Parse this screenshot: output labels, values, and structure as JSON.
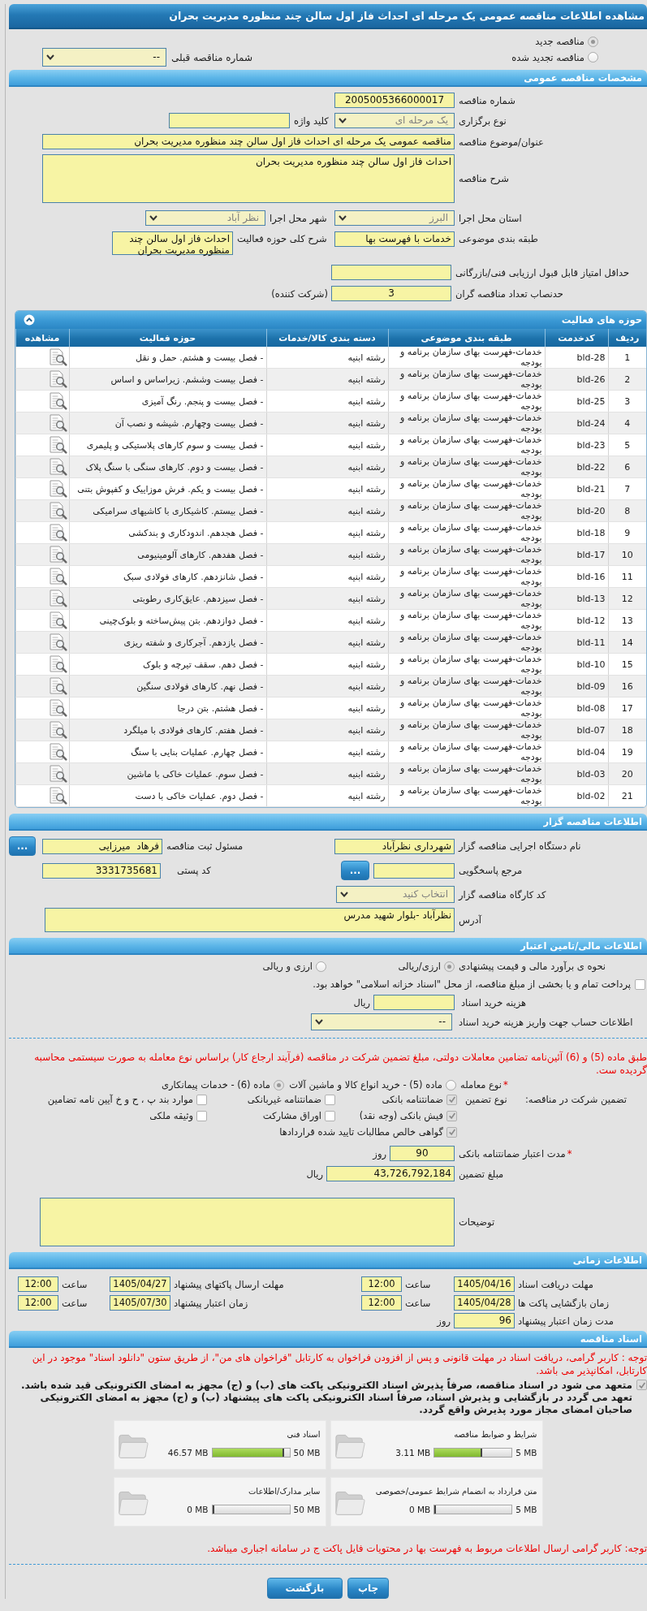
{
  "window": {
    "title": "مشاهده اطلاعات مناقصه عمومی یک مرحله ای احداث فاز اول سالن چند منظوره مدیریت بحران"
  },
  "tender_status": {
    "options": [
      {
        "label": "مناقصه جدید",
        "selected": true
      },
      {
        "label": "مناقصه تجدید شده",
        "selected": false
      }
    ],
    "previous_tender": {
      "label": "شماره مناقصه قبلی",
      "kind": "select",
      "value": "--",
      "disabled": false
    }
  },
  "general": {
    "title": "مشخصات مناقصه عمومی",
    "fields": [
      {
        "label": "شماره مناقصه",
        "kind": "input",
        "value": "2005005366000017"
      },
      {
        "label": "نوع برگزاری",
        "kind": "select",
        "value": "یک مرحله ای",
        "disabled": true
      },
      {
        "label": "کلید واژه",
        "kind": "input"
      },
      {
        "label": "عنوان/موضوع مناقصه",
        "kind": "input",
        "value": "مناقصه عمومی یک مرحله ای احداث فاز اول سالن چند منظوره مدیریت بحران"
      },
      {
        "label": "شرح مناقصه",
        "kind": "textarea",
        "value": "احداث فاز اول سالن چند منظوره مدیریت بحران"
      },
      {
        "label": "استان محل اجرا",
        "kind": "select",
        "value": "البرز",
        "disabled": true
      },
      {
        "label": "شهر محل اجرا",
        "kind": "select",
        "value": "نظر آباد",
        "disabled": true
      },
      {
        "label": "طبقه بندی موضوعی",
        "kind": "input",
        "value": "خدمات با فهرست بها"
      },
      {
        "label": "شرح کلی حوزه فعالیت",
        "kind": "textarea",
        "value": "احداث فاز اول سالن چند منظوره مدیریت بحران"
      },
      {
        "label": "حداقل امتیاز قابل قبول ارزیابی فنی/بازرگانی",
        "kind": "input"
      },
      {
        "label": "حدنصاب تعداد مناقصه گران",
        "kind": "input",
        "value": "3",
        "unit": "(شرکت کننده)"
      }
    ]
  },
  "activities": {
    "title": "حوزه های فعالیت",
    "expanded": true,
    "columns": [
      "ردیف",
      "کدخدمت",
      "طبقه بندی موضوعی",
      "دسته بندی کالا/خدمات",
      "حوزه فعالیت",
      "مشاهده"
    ],
    "rows": [
      {
        "number": "1",
        "code": "bld-28",
        "category": "خدمات-فهرست بهای سازمان برنامه و بودجه",
        "group": "رشته ابنیه",
        "activity": "- فصل بیست و هشتم. حمل و نقل"
      },
      {
        "number": "2",
        "code": "bld-26",
        "category": "خدمات-فهرست بهای سازمان برنامه و بودجه",
        "group": "رشته ابنیه",
        "activity": "- فصل بیست وششم. زیراساس و اساس"
      },
      {
        "number": "3",
        "code": "bld-25",
        "category": "خدمات-فهرست بهای سازمان برنامه و بودجه",
        "group": "رشته ابنیه",
        "activity": "- فصل بیست و پنجم. رنگ آمیزی"
      },
      {
        "number": "4",
        "code": "bld-24",
        "category": "خدمات-فهرست بهای سازمان برنامه و بودجه",
        "group": "رشته ابنیه",
        "activity": "- فصل بیست وچهارم. شیشه و نصب آن"
      },
      {
        "number": "5",
        "code": "bld-23",
        "category": "خدمات-فهرست بهای سازمان برنامه و بودجه",
        "group": "رشته ابنیه",
        "activity": "- فصل بیست و سوم کارهای پلاستیکی و پلیمری"
      },
      {
        "number": "6",
        "code": "bld-22",
        "category": "خدمات-فهرست بهای سازمان برنامه و بودجه",
        "group": "رشته ابنیه",
        "activity": "- فصل بیست و دوم. کارهای سنگی با سنگ پلاک"
      },
      {
        "number": "7",
        "code": "bld-21",
        "category": "خدمات-فهرست بهای سازمان برنامه و بودجه",
        "group": "رشته ابنیه",
        "activity": "- فصل بیست و یکم. فرش موزاییک و کفپوش بتنی"
      },
      {
        "number": "8",
        "code": "bld-20",
        "category": "خدمات-فهرست بهای سازمان برنامه و بودجه",
        "group": "رشته ابنیه",
        "activity": "- فصل بیستم. کاشیکاری با کاشیهای سرامیکی"
      },
      {
        "number": "9",
        "code": "bld-18",
        "category": "خدمات-فهرست بهای سازمان برنامه و بودجه",
        "group": "رشته ابنیه",
        "activity": "- فصل هجدهم. اندودکاری و بندکشی"
      },
      {
        "number": "10",
        "code": "bld-17",
        "category": "خدمات-فهرست بهای سازمان برنامه و بودجه",
        "group": "رشته ابنیه",
        "activity": "- فصل هفدهم. کارهای آلومینیومی"
      },
      {
        "number": "11",
        "code": "bld-16",
        "category": "خدمات-فهرست بهای سازمان برنامه و بودجه",
        "group": "رشته ابنیه",
        "activity": "- فصل شانزدهم. کارهای فولادی سبک"
      },
      {
        "number": "12",
        "code": "bld-13",
        "category": "خدمات-فهرست بهای سازمان برنامه و بودجه",
        "group": "رشته ابنیه",
        "activity": "- فصل سیزدهم. عایق‌کاری رطوبتی"
      },
      {
        "number": "13",
        "code": "bld-12",
        "category": "خدمات-فهرست بهای سازمان برنامه و بودجه",
        "group": "رشته ابنیه",
        "activity": "- فصل دوازدهم. بتن پیش‌ساخته و بلوک‌چینی"
      },
      {
        "number": "14",
        "code": "bld-11",
        "category": "خدمات-فهرست بهای سازمان برنامه و بودجه",
        "group": "رشته ابنیه",
        "activity": "- فصل یازدهم. آجرکاری و شفته ریزی"
      },
      {
        "number": "15",
        "code": "bld-10",
        "category": "خدمات-فهرست بهای سازمان برنامه و بودجه",
        "group": "رشته ابنیه",
        "activity": "- فصل دهم. سقف تیرچه و بلوک"
      },
      {
        "number": "16",
        "code": "bld-09",
        "category": "خدمات-فهرست بهای سازمان برنامه و بودجه",
        "group": "رشته ابنیه",
        "activity": "- فصل نهم. کارهای فولادی سنگین"
      },
      {
        "number": "17",
        "code": "bld-08",
        "category": "خدمات-فهرست بهای سازمان برنامه و بودجه",
        "group": "رشته ابنیه",
        "activity": "- فصل هشتم. بتن درجا"
      },
      {
        "number": "18",
        "code": "bld-07",
        "category": "خدمات-فهرست بهای سازمان برنامه و بودجه",
        "group": "رشته ابنیه",
        "activity": "- فصل هفتم. کارهای فولادی با میلگرد"
      },
      {
        "number": "19",
        "code": "bld-04",
        "category": "خدمات-فهرست بهای سازمان برنامه و بودجه",
        "group": "رشته ابنیه",
        "activity": "- فصل چهارم. عملیات بنایی با سنگ"
      },
      {
        "number": "20",
        "code": "bld-03",
        "category": "خدمات-فهرست بهای سازمان برنامه و بودجه",
        "group": "رشته ابنیه",
        "activity": "- فصل سوم. عملیات خاکی با ماشین"
      },
      {
        "number": "21",
        "code": "bld-02",
        "category": "خدمات-فهرست بهای سازمان برنامه و بودجه",
        "group": "رشته ابنیه",
        "activity": "- فصل دوم. عملیات خاکی با دست"
      }
    ]
  },
  "organizer": {
    "title": "اطلاعات مناقصه گزار",
    "fields": [
      {
        "label": "نام دستگاه اجرایی مناقصه گزار",
        "kind": "input",
        "value": "شهرداری نظرآباد"
      },
      {
        "label": "مسئول ثبت مناقصه",
        "kind": "input",
        "value": "فرهاد  میرزایی",
        "button": "..."
      },
      {
        "label": "مرجع پاسخگویی",
        "kind": "input",
        "button": "..."
      },
      {
        "label": "کد پستی",
        "kind": "input",
        "value": "3331735681"
      },
      {
        "label": "کد کارگاه مناقصه گزار",
        "kind": "select",
        "value": "انتخاب کنید",
        "disabled": true
      },
      {
        "label": "آدرس",
        "kind": "textarea",
        "value": "نظرآباد -بلوار شهید مدرس"
      }
    ]
  },
  "finance": {
    "title": "اطلاعات مالی/تامین اعتبار",
    "estimate": {
      "label": "نحوه ی برآورد مالی و قیمت پیشنهادی",
      "options": [
        {
          "label": "ارزی/ریالی",
          "selected": true
        },
        {
          "label": "ارزی و ریالی",
          "selected": false
        }
      ]
    },
    "treasury": {
      "label": "پرداخت تمام و یا بخشی از مبلغ مناقصه، از محل \"اسناد خزانه اسلامی\" خواهد بود.",
      "checked": false
    },
    "fields": [
      {
        "label": "هزینه خرید اسناد",
        "kind": "input",
        "unit": "ریال"
      },
      {
        "label": "اطلاعات حساب جهت واریز هزینه خرید اسناد",
        "kind": "select",
        "value": "--",
        "disabled": false
      }
    ],
    "note": "طبق ماده (5) و (6) آئین‌نامه تضامین معاملات دولتی، مبلغ تضمین شرکت در مناقصه (فرآیند ارجاع کار) براساس نوع معامله به صورت سیستمی محاسبه گردیده ست.",
    "deal_type": {
      "required_mark": "*",
      "label": "نوع معامله",
      "options": [
        {
          "label": "ماده (5) - خرید انواع کالا و ماشین آلات",
          "selected": false
        },
        {
          "label": "ماده (6) - خدمات پیمانکاری",
          "selected": true
        }
      ]
    },
    "guarantee": {
      "label": "تضمین شرکت در مناقصه:",
      "type_label": "نوع تضمین",
      "options": [
        {
          "label": "ضمانتنامه بانکی",
          "checked": true
        },
        {
          "label": "ضمانتنامه غیربانکی",
          "checked": false
        },
        {
          "label": "موارد بند پ ، ح و خ آیین نامه تضامین",
          "checked": false
        },
        {
          "label": "فیش بانکی (وجه نقد)",
          "checked": true
        },
        {
          "label": "اوراق مشارکت",
          "checked": false
        },
        {
          "label": "وثیقه ملکی",
          "checked": false
        },
        {
          "label": "گواهی خالص مطالبات تایید شده قراردادها",
          "checked": true
        }
      ]
    },
    "guarantee_fields": [
      {
        "required_mark": "*",
        "label": "مدت اعتبار ضمانتنامه بانکی",
        "kind": "input",
        "value": "90",
        "unit": "روز"
      },
      {
        "label": "مبلغ تضمین",
        "kind": "input",
        "value": "43,726,792,184",
        "unit": "ریال"
      },
      {
        "label": "توضیحات",
        "kind": "textarea"
      }
    ]
  },
  "timing": {
    "title": "اطلاعات زمانی",
    "entries": [
      {
        "label": "مهلت دریافت اسناد",
        "date": "1405/04/16",
        "time_label": "ساعت",
        "time": "12:00"
      },
      {
        "label": "مهلت ارسال پاکتهای پیشنهاد",
        "date": "1405/04/27",
        "time_label": "ساعت",
        "time": "12:00"
      },
      {
        "label": "زمان بازگشایی پاکت ها",
        "date": "1405/04/28",
        "time_label": "ساعت",
        "time": "12:00"
      },
      {
        "label": "زمان اعتبار پیشنهاد",
        "date": "1405/07/30",
        "time_label": "ساعت",
        "time": "12:00"
      }
    ],
    "validity": {
      "label": "مدت زمان اعتبار پیشنهاد",
      "kind": "input",
      "value": "96",
      "unit": "روز"
    }
  },
  "documents": {
    "title": "اسناد مناقصه",
    "notice": "توجه : کاربر گرامی، دریافت اسناد در مهلت قانونی و پس از افزودن فراخوان به کارتابل \"فراخوان های من\"، از طریق ستون \"دانلود اسناد\" موجود در این کارتابل، امکانپذیر می باشد.",
    "commitment": {
      "checked": true,
      "text": "متعهد می شود در اسناد مناقصه، صرفاً پذیرش اسناد الکترونیکی پاکت های (ب) و (ج) مجهز به امضای الکترونیکی قید شده باشد. تعهد می گردد در بازگشایی و پذیرش اسناد، صرفاً اسناد الکترونیکی پاکت های پیشنهاد (ب) و (ج) مجهز به امضای الکترونیکی صاحبان امضای مجاز مورد پذیرش واقع گردد."
    },
    "files": [
      {
        "title": "شرایط و ضوابط مناقصه",
        "limit": "5 MB",
        "used": "3.11 MB",
        "level": 0.62
      },
      {
        "title": "اسناد فنی",
        "limit": "50 MB",
        "used": "46.57 MB",
        "level": 0.93
      },
      {
        "title": "متن قرارداد به انضمام شرایط عمومی/خصوصی",
        "limit": "5 MB",
        "used": "0 MB",
        "level": 0
      },
      {
        "title": "سایر مدارک/اطلاعات",
        "limit": "50 MB",
        "used": "0 MB",
        "level": 0
      }
    ],
    "footer_note": "توجه: کاربر گرامی ارسال اطلاعات مربوط به فهرست بها در محتویات فایل پاکت ج در سامانه اجباری میباشد."
  },
  "buttons": [
    "چاپ",
    "بازگشت"
  ]
}
